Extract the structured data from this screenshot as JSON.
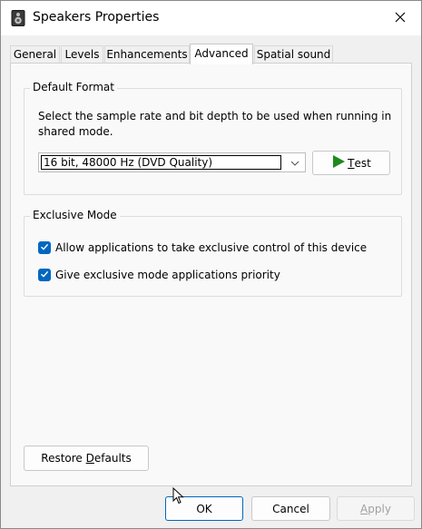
{
  "window": {
    "title": "Speakers Properties"
  },
  "tabs": [
    {
      "label": "General"
    },
    {
      "label": "Levels"
    },
    {
      "label": "Enhancements"
    },
    {
      "label": "Advanced",
      "active": true
    },
    {
      "label": "Spatial sound"
    }
  ],
  "default_format": {
    "group_label": "Default Format",
    "description": "Select the sample rate and bit depth to be used when running in shared mode.",
    "selected_format": "16 bit, 48000 Hz (DVD Quality)",
    "test_button": {
      "mnemonic": "T",
      "rest": "est"
    }
  },
  "exclusive_mode": {
    "group_label": "Exclusive Mode",
    "options": [
      {
        "label": "Allow applications to take exclusive control of this device",
        "checked": true
      },
      {
        "label": "Give exclusive mode applications priority",
        "checked": true
      }
    ]
  },
  "restore_defaults": {
    "prefix": "Restore ",
    "mnemonic": "D",
    "rest": "efaults"
  },
  "footer": {
    "ok_label": "OK",
    "cancel_label": "Cancel",
    "apply": {
      "mnemonic": "A",
      "rest": "pply",
      "disabled": true
    }
  },
  "colors": {
    "accent": "#0067c0",
    "test_play_icon": "#1e8a1e"
  },
  "icons": {
    "app": "speaker-icon",
    "close": "close-icon",
    "dropdown": "chevron-down-icon",
    "test": "play-icon",
    "checkbox": "check-icon",
    "pointer": "mouse-pointer-icon"
  }
}
